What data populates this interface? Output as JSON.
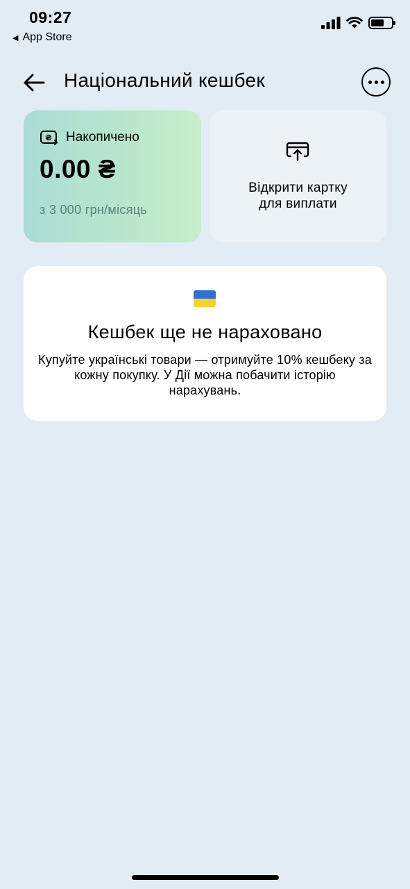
{
  "status_bar": {
    "time": "09:27",
    "back_app": "App Store",
    "signal_icon": "cellular-signal-icon",
    "wifi_icon": "wifi-icon",
    "battery_icon": "battery-icon",
    "battery_level": 0.65
  },
  "header": {
    "title": "Національний кешбек",
    "back_icon": "arrow-left-icon",
    "more_icon": "more-horizontal-icon"
  },
  "accumulated_card": {
    "label": "Накопичено",
    "icon": "cashback-wallet-icon",
    "amount": "0.00 ₴",
    "limit": "з 3 000 грн/місяць"
  },
  "open_card": {
    "icon": "card-upload-icon",
    "line1": "Відкрити картку",
    "line2": "для виплати"
  },
  "info_card": {
    "flag_icon": "ukraine-flag-icon",
    "title": "Кешбек ще не нараховано",
    "text": "Купуйте українські товари — отримуйте 10% кешбеку за кожну покупку. У Дії можна побачити історію нарахувань."
  },
  "colors": {
    "background": "#e2ecf4",
    "accum_gradient_start": "#aadcd6",
    "accum_gradient_end": "#c8efca",
    "limit_text": "#5a7f78",
    "flag_blue": "#2e6fd8",
    "flag_yellow": "#f7d22a"
  }
}
